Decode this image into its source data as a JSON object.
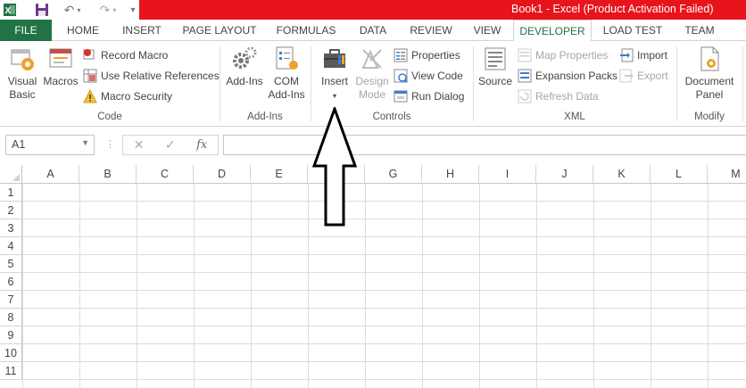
{
  "window": {
    "title": "Book1 - Excel (Product Activation Failed)"
  },
  "quick_access": {
    "excel_icon": "excel-logo-icon",
    "save_icon": "save-icon",
    "undo_icon": "undo-icon",
    "redo_icon": "redo-icon"
  },
  "tabs": [
    {
      "label": "FILE"
    },
    {
      "label": "HOME"
    },
    {
      "label": "INSERT"
    },
    {
      "label": "PAGE LAYOUT"
    },
    {
      "label": "FORMULAS"
    },
    {
      "label": "DATA"
    },
    {
      "label": "REVIEW"
    },
    {
      "label": "VIEW"
    },
    {
      "label": "DEVELOPER"
    },
    {
      "label": "LOAD TEST"
    },
    {
      "label": "TEAM"
    }
  ],
  "ribbon": {
    "code": {
      "label": "Code",
      "visual_basic": [
        "Visual",
        "Basic"
      ],
      "macros": "Macros",
      "record_macro": "Record Macro",
      "relative_refs": "Use Relative References",
      "macro_security": "Macro Security"
    },
    "addins": {
      "label": "Add-Ins",
      "addins": "Add-Ins",
      "com_addins": [
        "COM",
        "Add-Ins"
      ]
    },
    "controls": {
      "label": "Controls",
      "insert": "Insert",
      "design_mode": [
        "Design",
        "Mode"
      ],
      "properties": "Properties",
      "view_code": "View Code",
      "run_dialog": "Run Dialog"
    },
    "xml": {
      "label": "XML",
      "source": "Source",
      "map_properties": "Map Properties",
      "expansion_packs": "Expansion Packs",
      "refresh_data": "Refresh Data",
      "import": "Import",
      "export": "Export"
    },
    "modify": {
      "label": "Modify",
      "document_panel": [
        "Document",
        "Panel"
      ]
    }
  },
  "formula_bar": {
    "name_box": "A1",
    "fx": "fx",
    "cancel": "✕",
    "enter": "✓",
    "value": ""
  },
  "columns": [
    "A",
    "B",
    "C",
    "D",
    "E",
    "F",
    "G",
    "H",
    "I",
    "J",
    "K",
    "L",
    "M"
  ],
  "rows": [
    "1",
    "2",
    "3",
    "4",
    "5",
    "6",
    "7",
    "8",
    "9",
    "10",
    "11"
  ],
  "colors": {
    "title_red": "#e8141c",
    "excel_green": "#217346"
  }
}
